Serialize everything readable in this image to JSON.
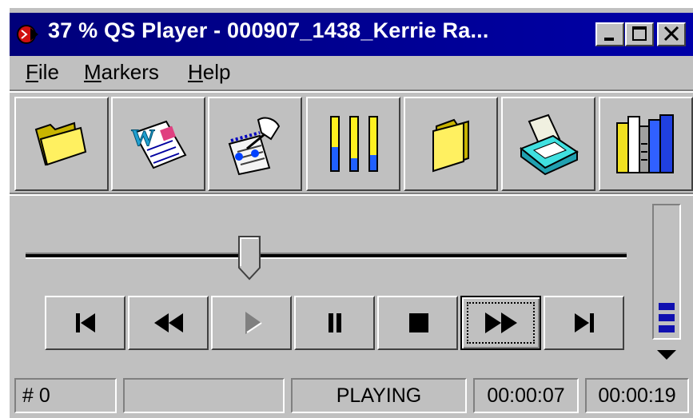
{
  "window": {
    "title": "37 % QS Player - 000907_1438_Kerrie Ra...",
    "title_color": "#ffffff",
    "titlebar_color": "#00007a",
    "face_color": "#c0c0c0",
    "controls": [
      "minimize-icon",
      "maximize-icon",
      "close-icon"
    ]
  },
  "menu": {
    "file": {
      "mnemonic": "F",
      "rest": "ile"
    },
    "markers": {
      "mnemonic": "M",
      "rest": "arkers"
    },
    "help": {
      "mnemonic": "H",
      "rest": "elp"
    }
  },
  "toolbar": {
    "icons": [
      "open-folder-icon",
      "word-document-icon",
      "notepad-pen-icon",
      "level-meters-icon",
      "closed-folder-icon",
      "tray-output-icon",
      "books-icon"
    ]
  },
  "transport": {
    "buttons": [
      "skip-to-start-icon",
      "rewind-icon",
      "play-icon",
      "pause-icon",
      "stop-icon",
      "fast-forward-icon",
      "skip-to-end-icon"
    ],
    "disabled": "play",
    "focused": "fast-forward"
  },
  "position_slider": {
    "fraction": 0.38
  },
  "volume": {
    "level_fraction": 0.12,
    "bar_color": "#1010b0"
  },
  "status": {
    "marker": "# 0",
    "info": "",
    "state": "PLAYING",
    "elapsed": "00:00:07",
    "total": "00:00:19"
  }
}
